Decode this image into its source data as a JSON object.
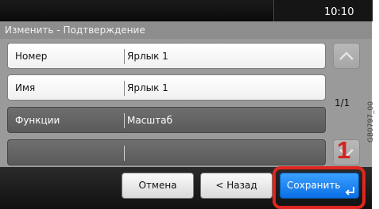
{
  "status_bar": {
    "time": "10:10"
  },
  "screen_title": "Изменить - Подтверждение",
  "rows": [
    {
      "label": "Номер",
      "value": "Ярлык 1"
    },
    {
      "label": "Имя",
      "value": "Ярлык 1"
    },
    {
      "label": "Функции",
      "value": "Масштаб"
    },
    {
      "label": "",
      "value": ""
    }
  ],
  "pager": "1/1",
  "buttons": {
    "cancel": "Отмена",
    "back": "< Назад",
    "save": "Сохранить"
  },
  "callout_number": "1",
  "figure_code": "GB0797_00",
  "colors": {
    "highlight": "#e0261f",
    "save_button": "#1a83f2",
    "selected_row": "#666666"
  }
}
